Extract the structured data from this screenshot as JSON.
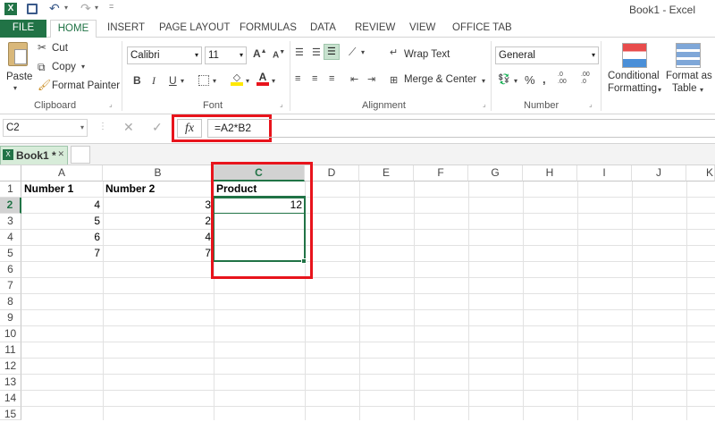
{
  "window": {
    "title": "Book1 - Excel"
  },
  "ribbon_tabs": [
    "FILE",
    "HOME",
    "INSERT",
    "PAGE LAYOUT",
    "FORMULAS",
    "DATA",
    "REVIEW",
    "VIEW",
    "OFFICE TAB"
  ],
  "clipboard": {
    "paste": "Paste",
    "cut": "Cut",
    "copy": "Copy",
    "format_painter": "Format Painter",
    "label": "Clipboard"
  },
  "font": {
    "name": "Calibri",
    "size": "11",
    "label": "Font"
  },
  "alignment": {
    "wrap": "Wrap Text",
    "merge": "Merge & Center",
    "label": "Alignment"
  },
  "number": {
    "format": "General",
    "label": "Number"
  },
  "styles": {
    "conditional_1": "Conditional",
    "conditional_2": "Formatting",
    "format_as_1": "Format as",
    "format_as_2": "Table"
  },
  "formula_bar": {
    "name_box": "C2",
    "fx": "fx",
    "formula": "=A2*B2"
  },
  "workbook_tab": "Book1 *",
  "columns": [
    "A",
    "B",
    "C",
    "D",
    "E",
    "F",
    "G",
    "H",
    "I",
    "J",
    "K"
  ],
  "rows": [
    "1",
    "2",
    "3",
    "4",
    "5",
    "6",
    "7",
    "8",
    "9",
    "10",
    "11",
    "12",
    "13",
    "14",
    "15"
  ],
  "cells": {
    "A1": "Number 1",
    "B1": "Number 2",
    "C1": "Product",
    "A2": "4",
    "B2": "3",
    "C2": "12",
    "A3": "5",
    "B3": "2",
    "A4": "6",
    "B4": "4",
    "A5": "7",
    "B5": "7"
  }
}
